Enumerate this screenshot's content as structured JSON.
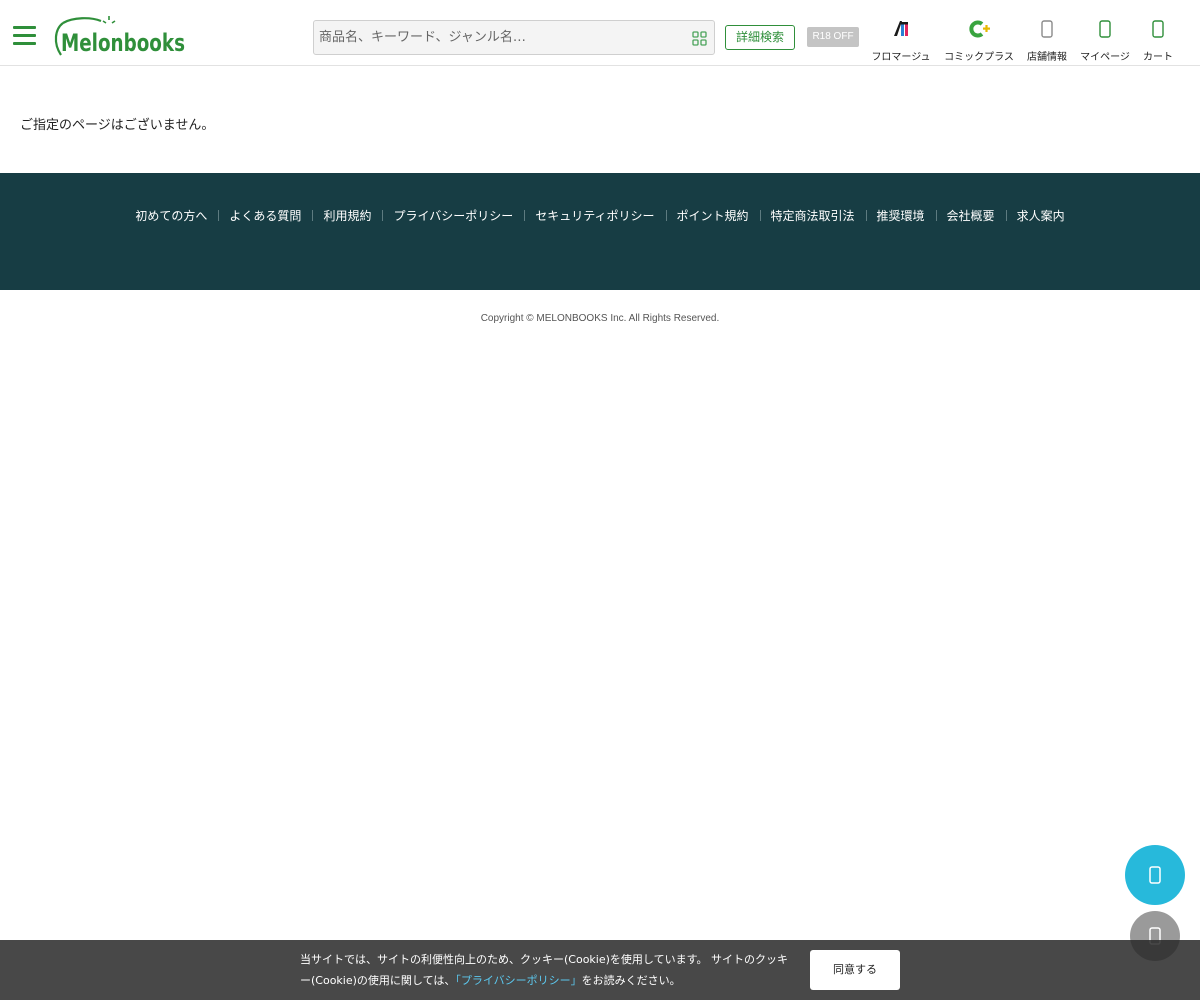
{
  "header": {
    "logo_text": "Melonbooks",
    "search": {
      "placeholder": "商品名、キーワード、ジャンル名…",
      "value": ""
    },
    "advanced_search_label": "詳細検索",
    "r18_toggle_label": "R18 OFF",
    "nav": [
      {
        "label": "フロマージュ",
        "icon": "fromage-logo-icon"
      },
      {
        "label": "コミックプラス",
        "icon": "comicplus-logo-icon"
      },
      {
        "label": "店舗情報",
        "icon": "store-icon"
      },
      {
        "label": "マイページ",
        "icon": "user-icon"
      },
      {
        "label": "カート",
        "icon": "cart-icon"
      }
    ]
  },
  "main": {
    "message": "ご指定のページはございません。"
  },
  "footer": {
    "links": [
      "初めての方へ",
      "よくある質問",
      "利用規約",
      "プライバシーポリシー",
      "セキュリティポリシー",
      "ポイント規約",
      "特定商法取引法",
      "推奨環境",
      "会社概要",
      "求人案内"
    ],
    "copyright": "Copyright © MELONBOOKS Inc. All Rights Reserved."
  },
  "cookie": {
    "text_before": "当サイトでは、サイトの利便性向上のため、クッキー(Cookie)を使用しています。 サイトのクッキー(Cookie)の使用に関しては、",
    "link_label": "「プライバシーポリシー」",
    "text_after": "をお読みください。",
    "agree_label": "同意する"
  },
  "colors": {
    "brand_green": "#2f8f3a",
    "footer_bg": "#173d44",
    "chat_button": "#27b9db",
    "cookie_link": "#5cc8ee"
  }
}
